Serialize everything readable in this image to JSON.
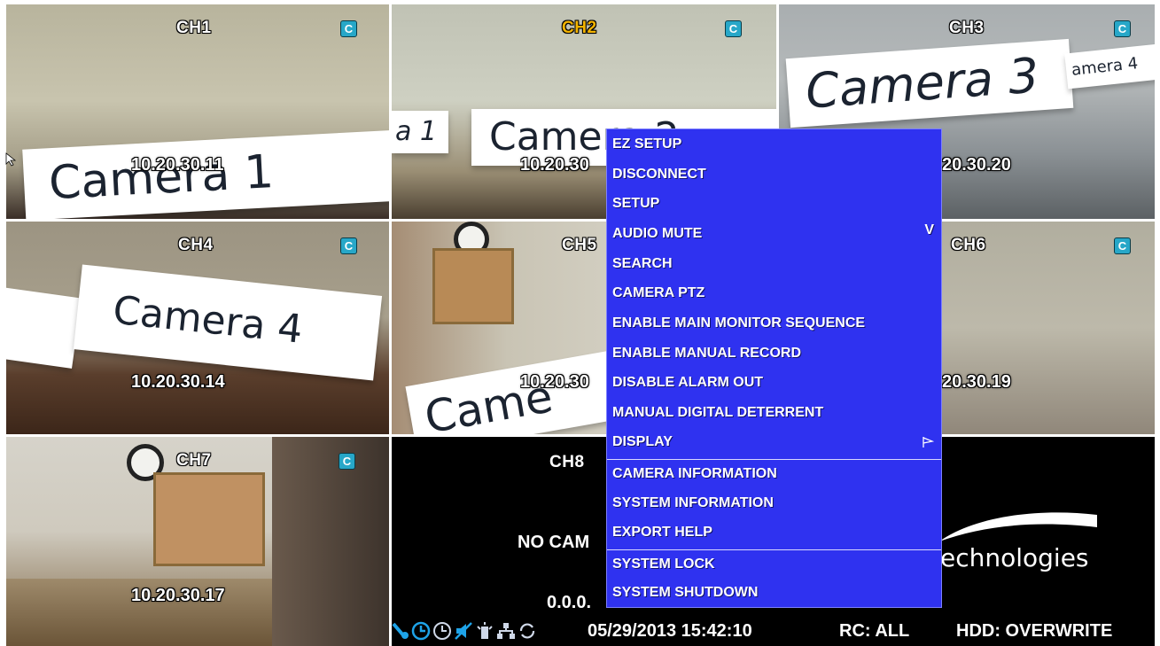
{
  "channels": [
    {
      "label": "CH1",
      "badge": "C",
      "ip": "10.20.30.11",
      "sign": "Camera 1"
    },
    {
      "label": "CH2",
      "badge": "C",
      "ip": "10.20.30",
      "sign": "Camera 2"
    },
    {
      "label": "CH3",
      "badge": "C",
      "ip": "20.30.20",
      "sign": "Camera 3"
    },
    {
      "label": "CH4",
      "badge": "C",
      "ip": "10.20.30.14",
      "sign": "Camera 4"
    },
    {
      "label": "CH5",
      "ip": "10.20.30",
      "sign": "Came"
    },
    {
      "label": "CH6",
      "badge": "C",
      "ip": "20.30.19"
    },
    {
      "label": "CH7",
      "badge": "C",
      "ip": "10.20.30.17"
    },
    {
      "label": "CH8",
      "status": "NO CAM",
      "ip": "0.0.0."
    }
  ],
  "logo_text": "echnologies",
  "menu": {
    "items": [
      {
        "label": "EZ SETUP"
      },
      {
        "label": "DISCONNECT"
      },
      {
        "label": "SETUP"
      },
      {
        "label": "AUDIO MUTE",
        "mark": "V"
      },
      {
        "label": "SEARCH"
      },
      {
        "label": "CAMERA PTZ"
      },
      {
        "label": "ENABLE MAIN MONITOR SEQUENCE"
      },
      {
        "label": "ENABLE MANUAL RECORD"
      },
      {
        "label": "DISABLE ALARM OUT"
      },
      {
        "label": "MANUAL DIGITAL DETERRENT"
      },
      {
        "label": "DISPLAY",
        "arrow": "submenu-arrow-icon"
      },
      {
        "label": "CAMERA INFORMATION"
      },
      {
        "label": "SYSTEM INFORMATION"
      },
      {
        "label": "EXPORT HELP"
      },
      {
        "label": "SYSTEM LOCK"
      },
      {
        "label": "SYSTEM SHUTDOWN"
      }
    ]
  },
  "status_bar": {
    "datetime": "05/29/2013 15:42:10",
    "rc": "RC: ALL",
    "hdd": "HDD: OVERWRITE",
    "icons": [
      "network-icon",
      "schedule-icon",
      "clock-icon",
      "mute-icon",
      "alarm-icon",
      "network-tree-icon",
      "sync-icon"
    ]
  },
  "colors": {
    "menu_bg": "#2f32f0",
    "active_channel": "#f4b400",
    "badge": "#27a7c8"
  }
}
